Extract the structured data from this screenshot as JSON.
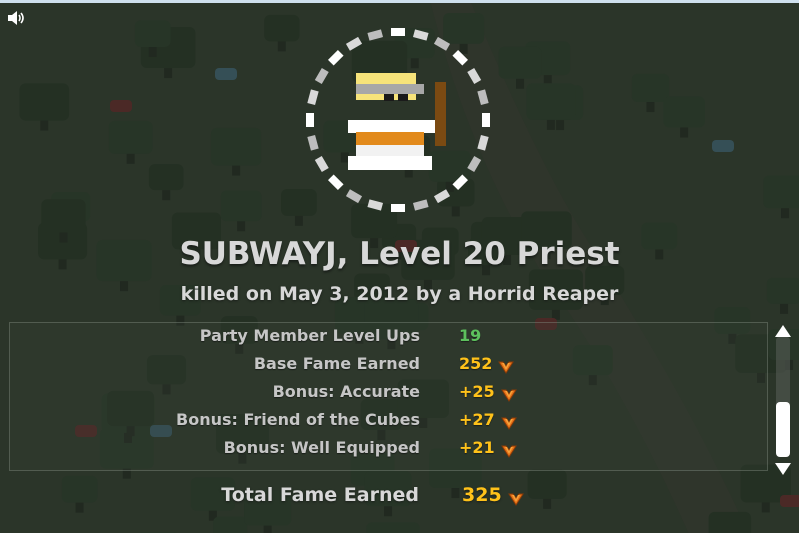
{
  "header": {
    "sound_icon": "speaker-icon",
    "title": "SUBWAYJ, Level 20 Priest",
    "subtitle": "killed on May 3, 2012 by a Horrid Reaper"
  },
  "character": {
    "icon": "priest-character-icon"
  },
  "stats": [
    {
      "label": "Party Member Level Ups",
      "value": "19",
      "color": "#5dc05d",
      "icon": ""
    },
    {
      "label": "Base Fame Earned",
      "value": "252",
      "color": "#ffc21a",
      "icon": "fame-icon"
    },
    {
      "label": "Bonus: Accurate",
      "value": "+25",
      "color": "#ffc21a",
      "icon": "fame-icon"
    },
    {
      "label": "Bonus: Friend of the Cubes",
      "value": "+27",
      "color": "#ffc21a",
      "icon": "fame-icon"
    },
    {
      "label": "Bonus: Well Equipped",
      "value": "+21",
      "color": "#ffc21a",
      "icon": "fame-icon"
    }
  ],
  "total": {
    "label": "Total Fame Earned",
    "value": "325",
    "color": "#ffc21a",
    "icon": "fame-icon"
  },
  "scrollbar": {
    "position": 1.0
  },
  "colors": {
    "fame": "#ffc21a",
    "level_ups": "#5dc05d",
    "text": "#d8d8d8",
    "background": "#2f3a2e"
  }
}
